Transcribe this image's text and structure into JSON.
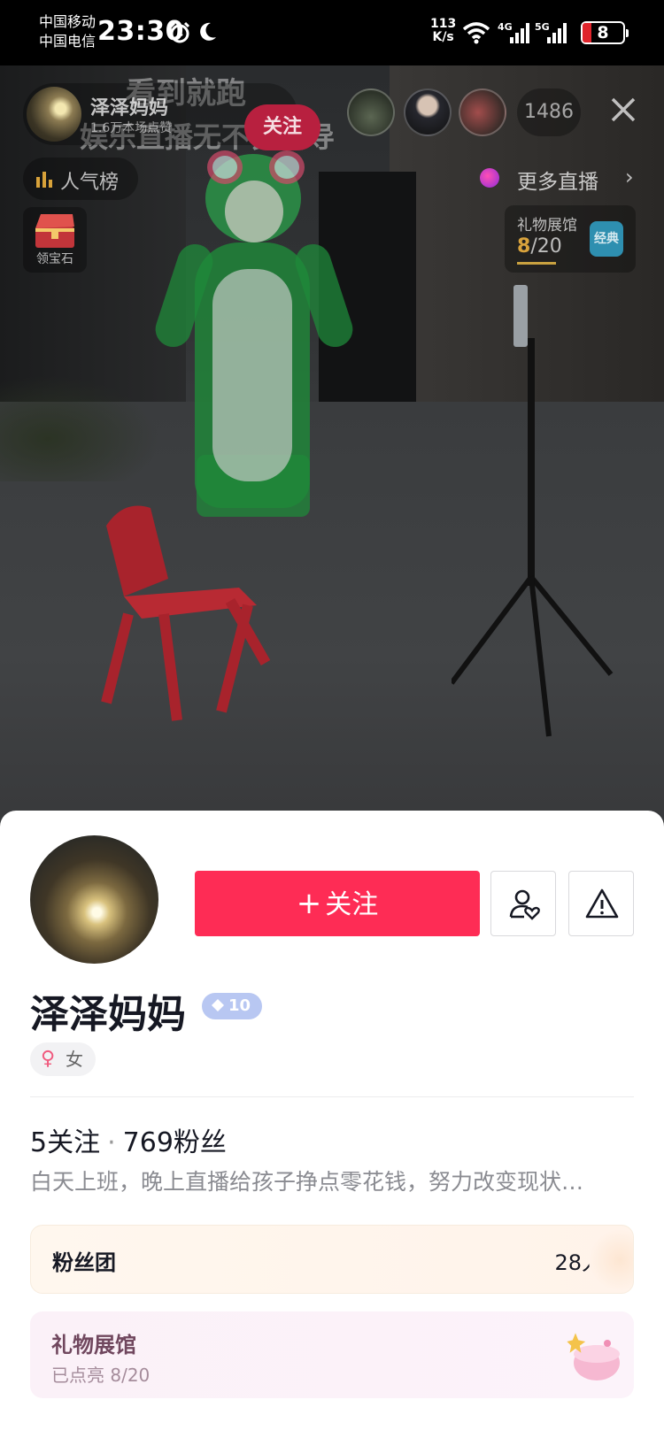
{
  "status_bar": {
    "carrier_1": "中国移动",
    "carrier_2": "中国电信",
    "time": "23:30",
    "net_speed_value": "113",
    "net_speed_unit": "K/s",
    "signal_1_label": "4G",
    "signal_2_label": "5G",
    "battery": "8"
  },
  "live": {
    "overlay_line_1": "看到就跑",
    "overlay_line_2": "娱乐直播无不良引导",
    "host_name": "泽泽妈妈",
    "host_sub": "1.6万本场点赞",
    "follow_label": "关注",
    "viewer_count": "1486",
    "rank_label": "人气榜",
    "more_live_label": "更多直播",
    "gem_label": "领宝石",
    "gift_hall_title": "礼物展馆",
    "gift_hall_lit": "8",
    "gift_hall_total": "/20",
    "gift_hall_badge": "经典"
  },
  "profile": {
    "follow_button_plus": "+",
    "follow_button_label": "关注",
    "name": "泽泽妈妈",
    "level": "10",
    "gender_symbol": "♀",
    "gender": "女",
    "following_count": "5",
    "following_label": "关注",
    "separator": "·",
    "fans_count": "769",
    "fans_label": "粉丝",
    "bio": "白天上班，晚上直播给孩子挣点零花钱，努力改变现状…"
  },
  "fan_club": {
    "title": "粉丝团",
    "count": "28人"
  },
  "gift_gallery": {
    "title": "礼物展馆",
    "subtitle": "已点亮 8/20"
  },
  "colors": {
    "primary": "#fe2c55",
    "gold": "#c9a140",
    "level_badge": "#b8c7f2"
  }
}
